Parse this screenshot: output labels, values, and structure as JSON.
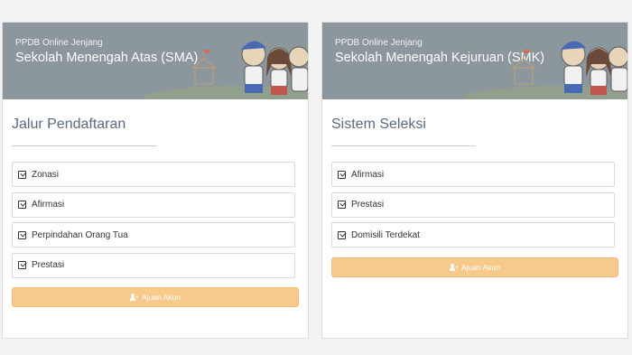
{
  "cards": [
    {
      "banner_sub": "PPDB Online Jenjang",
      "banner_title": "Sekolah Menengah Atas (SMA)",
      "section_title": "Jalur Pendaftaran",
      "options": [
        "Zonasi",
        "Afirmasi",
        "Perpindahan Orang Tua",
        "Prestasi"
      ],
      "button_label": "Ajuan Akun"
    },
    {
      "banner_sub": "PPDB Online Jenjang",
      "banner_title": "Sekolah Menengah Kejuruan (SMK)",
      "section_title": "Sistem Seleksi",
      "options": [
        "Afirmasi",
        "Prestasi",
        "Domisili Terdekat"
      ],
      "button_label": "Ajuan Akun"
    }
  ],
  "icons": {
    "check": "check-square-icon",
    "button": "user-plus-icon"
  },
  "colors": {
    "banner": "#8b969d",
    "button": "#f7ca8c",
    "title": "#5a6a7e"
  }
}
